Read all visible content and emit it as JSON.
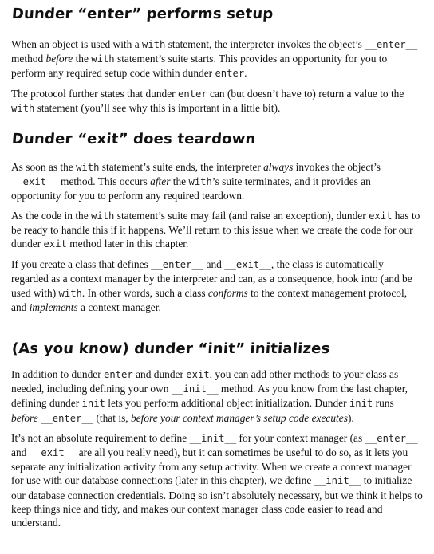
{
  "sections": [
    {
      "title": "Dunder “enter” performs setup",
      "p1": [
        {
          "t": "text",
          "v": "When an object is used with a "
        },
        {
          "t": "code",
          "v": "with"
        },
        {
          "t": "text",
          "v": " statement, the interpreter invokes the object’s "
        },
        {
          "t": "code",
          "v": "__enter__"
        },
        {
          "t": "text",
          "v": " method "
        },
        {
          "t": "em",
          "v": "before"
        },
        {
          "t": "text",
          "v": " the "
        },
        {
          "t": "code",
          "v": "with"
        },
        {
          "t": "text",
          "v": " statement’s suite starts. This provides an opportunity for you to perform any required setup code within dunder "
        },
        {
          "t": "code",
          "v": "enter"
        },
        {
          "t": "text",
          "v": "."
        }
      ],
      "p2": [
        {
          "t": "text",
          "v": "The protocol further states that dunder "
        },
        {
          "t": "code",
          "v": "enter"
        },
        {
          "t": "text",
          "v": " can (but doesn’t have to) return a value to the "
        },
        {
          "t": "code",
          "v": "with"
        },
        {
          "t": "text",
          "v": " statement (you’ll see why this is important in a little bit)."
        }
      ]
    },
    {
      "title": "Dunder “exit” does teardown",
      "p1": [
        {
          "t": "text",
          "v": "As soon as the "
        },
        {
          "t": "code",
          "v": "with"
        },
        {
          "t": "text",
          "v": " statement’s suite ends, the interpreter "
        },
        {
          "t": "em",
          "v": "always"
        },
        {
          "t": "text",
          "v": " invokes the object’s "
        },
        {
          "t": "code",
          "v": "__exit__"
        },
        {
          "t": "text",
          "v": " method. This occurs "
        },
        {
          "t": "em",
          "v": "after"
        },
        {
          "t": "text",
          "v": " the "
        },
        {
          "t": "code",
          "v": "with"
        },
        {
          "t": "text",
          "v": "’s suite terminates, and it provides an opportunity for you to perform any required teardown."
        }
      ],
      "p2": [
        {
          "t": "text",
          "v": "As the code in the "
        },
        {
          "t": "code",
          "v": "with"
        },
        {
          "t": "text",
          "v": " statement’s suite may fail (and raise an exception), dunder "
        },
        {
          "t": "code",
          "v": "exit"
        },
        {
          "t": "text",
          "v": " has to be ready to handle this if it happens. We’ll return to this issue when we create the code for our dunder "
        },
        {
          "t": "code",
          "v": "exit"
        },
        {
          "t": "text",
          "v": " method later in this chapter."
        }
      ],
      "p3": [
        {
          "t": "text",
          "v": "If you create a class that defines "
        },
        {
          "t": "code",
          "v": "__enter__"
        },
        {
          "t": "text",
          "v": " and "
        },
        {
          "t": "code",
          "v": "__exit__"
        },
        {
          "t": "text",
          "v": ", the class is automatically regarded as a context manager by the interpreter and can, as a consequence, hook into (and be used with) "
        },
        {
          "t": "code",
          "v": "with"
        },
        {
          "t": "text",
          "v": ". In other words, such a class "
        },
        {
          "t": "em",
          "v": "conforms"
        },
        {
          "t": "text",
          "v": " to the context management protocol, and "
        },
        {
          "t": "em",
          "v": "implements"
        },
        {
          "t": "text",
          "v": " a context manager."
        }
      ]
    },
    {
      "title": "(As you know) dunder “init” initializes",
      "p1": [
        {
          "t": "text",
          "v": "In addition to dunder "
        },
        {
          "t": "code",
          "v": "enter"
        },
        {
          "t": "text",
          "v": " and dunder "
        },
        {
          "t": "code",
          "v": "exit"
        },
        {
          "t": "text",
          "v": ", you can add other methods to your class as needed, including defining your own "
        },
        {
          "t": "code",
          "v": "__init__"
        },
        {
          "t": "text",
          "v": " method. As you know from the last chapter, defining dunder "
        },
        {
          "t": "code",
          "v": "init"
        },
        {
          "t": "text",
          "v": " lets you perform additional object initialization. Dunder "
        },
        {
          "t": "code",
          "v": "init"
        },
        {
          "t": "text",
          "v": " runs "
        },
        {
          "t": "em",
          "v": "before"
        },
        {
          "t": "text",
          "v": " "
        },
        {
          "t": "code",
          "v": "__enter__"
        },
        {
          "t": "text",
          "v": " (that is, "
        },
        {
          "t": "em",
          "v": "before your context manager’s setup code executes"
        },
        {
          "t": "text",
          "v": ")."
        }
      ],
      "p2": [
        {
          "t": "text",
          "v": "It’s not an absolute requirement to define "
        },
        {
          "t": "code",
          "v": "__init__"
        },
        {
          "t": "text",
          "v": " for your context manager (as "
        },
        {
          "t": "code",
          "v": "__enter__"
        },
        {
          "t": "text",
          "v": " and "
        },
        {
          "t": "code",
          "v": "__exit__"
        },
        {
          "t": "text",
          "v": " are all you really need), but it can sometimes be useful to do so, as it lets you separate any initialization activity from any setup activity. When we create a context manager for use with our database connections (later in this chapter), we define "
        },
        {
          "t": "code",
          "v": "__init__"
        },
        {
          "t": "text",
          "v": " to initialize our database connection credentials. Doing so isn’t absolutely necessary, but we think it helps to keep things nice and tidy, and makes our context manager class code easier to read and understand."
        }
      ]
    }
  ]
}
